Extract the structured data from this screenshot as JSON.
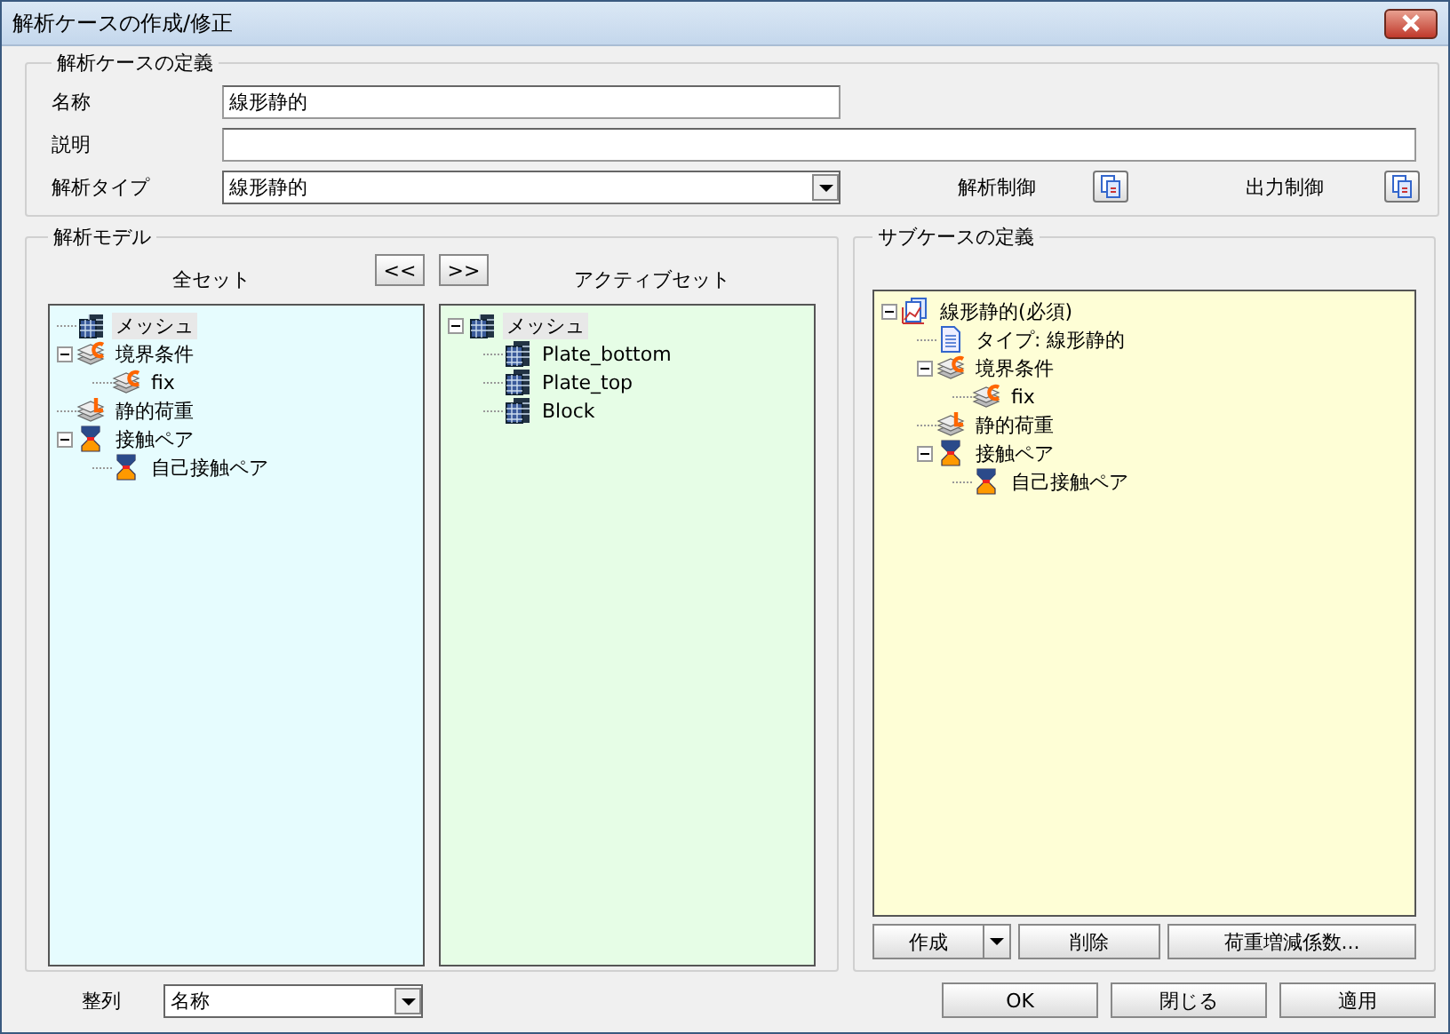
{
  "window": {
    "title": "解析ケースの作成/修正"
  },
  "definition": {
    "title": "解析ケースの定義",
    "name_label": "名称",
    "name_value": "線形静的",
    "description_label": "説明",
    "type_label": "解析タイプ",
    "type_value": "線形静的",
    "analysis_control_label": "解析制御",
    "output_control_label": "出力制御"
  },
  "model": {
    "title": "解析モデル",
    "all_set_label": "全セット",
    "active_set_label": "アクティブセット",
    "remove_button": "<<",
    "add_button": ">>",
    "all_set": [
      {
        "label": "メッシュ",
        "kind": "mesh",
        "selected": true
      },
      {
        "label": "境界条件",
        "kind": "bc",
        "selected": false,
        "expanded": true,
        "children": [
          {
            "label": "fix",
            "kind": "bc",
            "selected": false
          }
        ]
      },
      {
        "label": "静的荷重",
        "kind": "load",
        "selected": false
      },
      {
        "label": "接触ペア",
        "kind": "contact",
        "selected": false,
        "expanded": true,
        "children": [
          {
            "label": "自己接触ペア",
            "kind": "contact",
            "selected": false
          }
        ]
      }
    ],
    "active_set": [
      {
        "label": "メッシュ",
        "kind": "mesh",
        "selected": true,
        "expanded": true,
        "children": [
          {
            "label": "Plate_bottom",
            "kind": "part",
            "selected": false
          },
          {
            "label": "Plate_top",
            "kind": "part",
            "selected": false
          },
          {
            "label": "Block",
            "kind": "part",
            "selected": false
          }
        ]
      }
    ]
  },
  "subcase": {
    "title": "サブケースの定義",
    "tree": [
      {
        "label": "線形静的(必須)",
        "kind": "analysis",
        "selected": false,
        "expanded": true,
        "children": [
          {
            "label": "タイプ: 線形静的",
            "kind": "doc",
            "selected": false
          },
          {
            "label": "境界条件",
            "kind": "bc",
            "selected": false,
            "expanded": true,
            "children": [
              {
                "label": "fix",
                "kind": "bc",
                "selected": false
              }
            ]
          },
          {
            "label": "静的荷重",
            "kind": "load",
            "selected": false
          },
          {
            "label": "接触ペア",
            "kind": "contact",
            "selected": false,
            "expanded": true,
            "children": [
              {
                "label": "自己接触ペア",
                "kind": "contact",
                "selected": false
              }
            ]
          }
        ]
      }
    ],
    "create_button": "作成",
    "delete_button": "削除",
    "load_factor_button": "荷重増減係数..."
  },
  "sort": {
    "label": "整列",
    "value": "名称"
  },
  "buttons": [
    "OK",
    "閉じる",
    "適用"
  ]
}
